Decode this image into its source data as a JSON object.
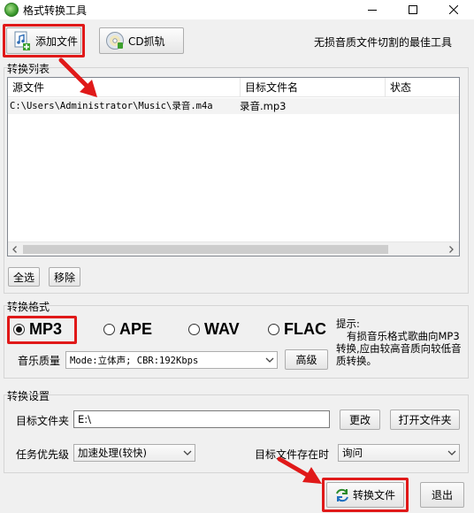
{
  "window": {
    "title": "格式转换工具",
    "controls": [
      "minimize",
      "maximize",
      "close"
    ]
  },
  "toolbar": {
    "add_file_label": "添加文件",
    "cd_rip_label": "CD抓轨",
    "slogan": "无损音质文件切割的最佳工具"
  },
  "convert_list": {
    "label": "转换列表",
    "columns": [
      "源文件",
      "目标文件名",
      "状态"
    ],
    "rows": [
      {
        "source": "C:\\Users\\Administrator\\Music\\录音.m4a",
        "target": "录音.mp3",
        "status": ""
      }
    ],
    "select_all_label": "全选",
    "remove_label": "移除"
  },
  "format": {
    "label": "转换格式",
    "options": [
      "MP3",
      "APE",
      "WAV",
      "FLAC"
    ],
    "selected": "MP3",
    "hint_title": "提示:",
    "hint_body": "有损音乐格式歌曲向MP3转换,应由较高音质向较低音质转换。",
    "quality_label": "音乐质量",
    "quality_value": "Mode:立体声; CBR:192Kbps",
    "advanced_label": "高级"
  },
  "settings": {
    "label": "转换设置",
    "target_folder_label": "目标文件夹",
    "target_folder_value": "E:\\",
    "change_label": "更改",
    "open_folder_label": "打开文件夹",
    "priority_label": "任务优先级",
    "priority_value": "加速处理(较快)",
    "exists_label": "目标文件存在时",
    "exists_value": "询问"
  },
  "actions": {
    "convert_label": "转换文件",
    "exit_label": "退出"
  },
  "annotation": {
    "highlight_color": "#e01919"
  }
}
